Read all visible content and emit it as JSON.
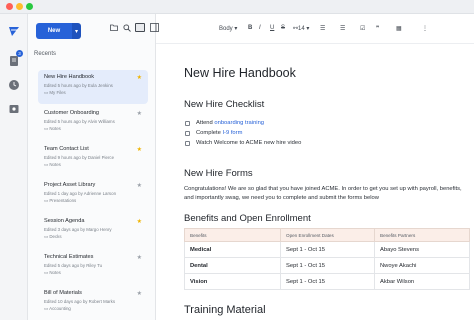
{
  "window": {
    "dot_colors": [
      "#ff5f57",
      "#febc2e",
      "#28c840"
    ]
  },
  "rail": {
    "badge": "3",
    "icons": [
      "logo-icon",
      "document-icon",
      "clock-icon",
      "media-icon"
    ]
  },
  "sidebar": {
    "new_label": "New",
    "recent_heading": "Recents",
    "items": [
      {
        "title": "New Hire Handbook",
        "meta": "Edited 5 hours ago by Eula Jenkins",
        "folder": "My Files",
        "starred": true,
        "active": true
      },
      {
        "title": "Customer Onboarding",
        "meta": "Edited 5 hours ago by Alvin Williams",
        "folder": "Notes",
        "starred": false,
        "active": false
      },
      {
        "title": "Team Contact List",
        "meta": "Edited 9 hours ago by Daniel Pierce",
        "folder": "Notes",
        "starred": true,
        "active": false
      },
      {
        "title": "Project Asset Library",
        "meta": "Edited 1 day ago by Adrienne Larson",
        "folder": "Presentations",
        "starred": false,
        "active": false
      },
      {
        "title": "Session Agenda",
        "meta": "Edited 3 days ago by Margo Henry",
        "folder": "Decks",
        "starred": true,
        "active": false
      },
      {
        "title": "Technical Estimates",
        "meta": "Edited 5 days ago by Riley Tu",
        "folder": "Notes",
        "starred": false,
        "active": false
      },
      {
        "title": "Bill of Materials",
        "meta": "Edited 10 days ago by Robert Marks",
        "folder": "Accounting",
        "starred": false,
        "active": false
      }
    ]
  },
  "toolbar": {
    "style_select": "Body",
    "font_size": "14",
    "bold": "B",
    "italic": "I",
    "underline": "U",
    "strike": "S"
  },
  "document": {
    "title": "New Hire Handbook",
    "checklist_heading": "New Hire Checklist",
    "checklist": [
      {
        "prefix": "Attend ",
        "link": "onboarding training",
        "suffix": ""
      },
      {
        "prefix": "Complete ",
        "link": "I-9 form",
        "suffix": ""
      },
      {
        "prefix": "Watch Welcome to ACME new hire video",
        "link": "",
        "suffix": ""
      }
    ],
    "forms_heading": "New Hire Forms",
    "forms_paragraph": "Congratulations! We are so glad that you have joined ACME. In order to get you set up with payroll, benefits, and importantly swag, we need you to complete and submit the forms below",
    "benefits_heading": "Benefits and Open Enrollment",
    "table": {
      "headers": [
        "Benefits",
        "Open Enrollment Dates",
        "Benefits Partners"
      ],
      "rows": [
        [
          "Medical",
          "Sept 1 - Oct 15",
          "Abayo Stevens"
        ],
        [
          "Dental",
          "Sept 1 - Oct 15",
          "Nwoye Akachi"
        ],
        [
          "Vision",
          "Sept 1 - Oct 15",
          "Akbar Wilson"
        ]
      ]
    },
    "training_heading": "Training Material"
  }
}
